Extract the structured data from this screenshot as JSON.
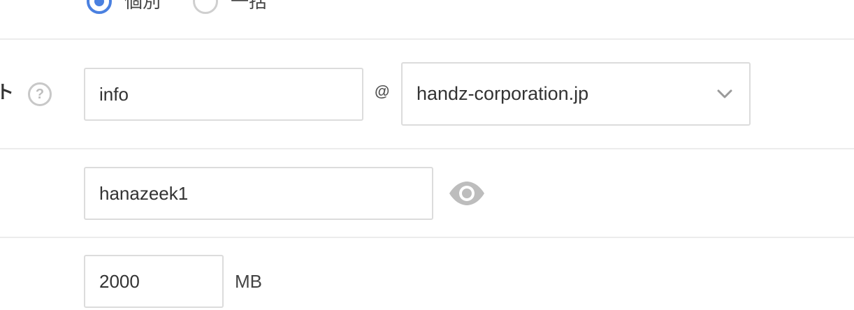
{
  "mail_type": {
    "options": [
      {
        "label": "個別",
        "selected": true
      },
      {
        "label": "一括",
        "selected": false
      }
    ]
  },
  "account": {
    "label_fragment": "ト",
    "help_symbol": "?",
    "local_part": "info",
    "at_symbol": "@",
    "domain": "handz-corporation.jp"
  },
  "password": {
    "value": "hanazeek1",
    "visibility_icon": "eye-icon"
  },
  "quota": {
    "value": "2000",
    "unit": "MB"
  },
  "colors": {
    "accent": "#4a80e0",
    "border": "#dcdcdc",
    "icon_gray": "#bdbdbd"
  }
}
